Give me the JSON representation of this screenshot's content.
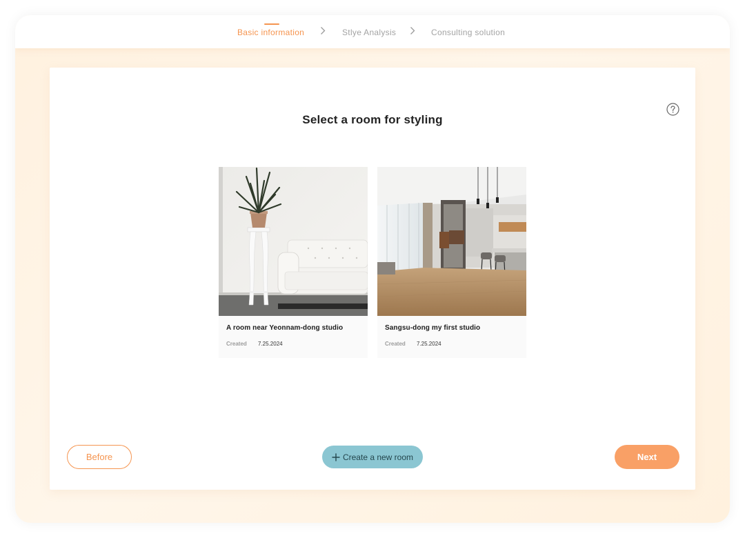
{
  "stepper": {
    "steps": [
      {
        "label": "Basic information",
        "active": true
      },
      {
        "label": "Stlye Analysis",
        "active": false
      },
      {
        "label": "Consulting solution",
        "active": false
      }
    ]
  },
  "main": {
    "title": "Select a room for styling",
    "help_icon": "question-circle-icon",
    "rooms": [
      {
        "name": "A room near Yeonnam-dong studio",
        "created_label": "Created",
        "created_date": "7.25.2024"
      },
      {
        "name": "Sangsu-dong my first studio",
        "created_label": "Created",
        "created_date": "7.25.2024"
      }
    ]
  },
  "actions": {
    "before_label": "Before",
    "create_label": "Create a new room",
    "create_icon": "plus-icon",
    "next_label": "Next"
  },
  "colors": {
    "accent": "#f5944f",
    "next_button": "#f9a066",
    "create_button": "#8bc6d2",
    "background": "#fff3e4"
  }
}
